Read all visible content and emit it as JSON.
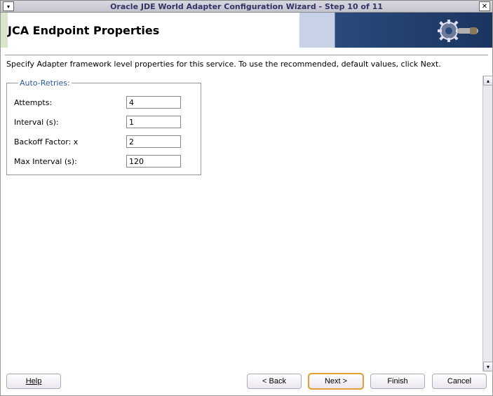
{
  "window": {
    "title": "Oracle JDE World Adapter Configuration Wizard - Step 10 of 11"
  },
  "header": {
    "title": "JCA Endpoint Properties"
  },
  "description": "Specify Adapter framework level properties for this service.  To use the recommended, default values, click Next.",
  "fieldset": {
    "legend": "Auto-Retries:",
    "fields": {
      "attempts": {
        "label": "Attempts:",
        "value": "4"
      },
      "interval": {
        "label": "Interval (s):",
        "value": "1"
      },
      "backoff": {
        "label": "Backoff Factor: x",
        "value": "2"
      },
      "maxinterval": {
        "label": "Max Interval (s):",
        "value": "120"
      }
    }
  },
  "buttons": {
    "help": "Help",
    "back": "< Back",
    "next": "Next >",
    "finish": "Finish",
    "cancel": "Cancel"
  }
}
